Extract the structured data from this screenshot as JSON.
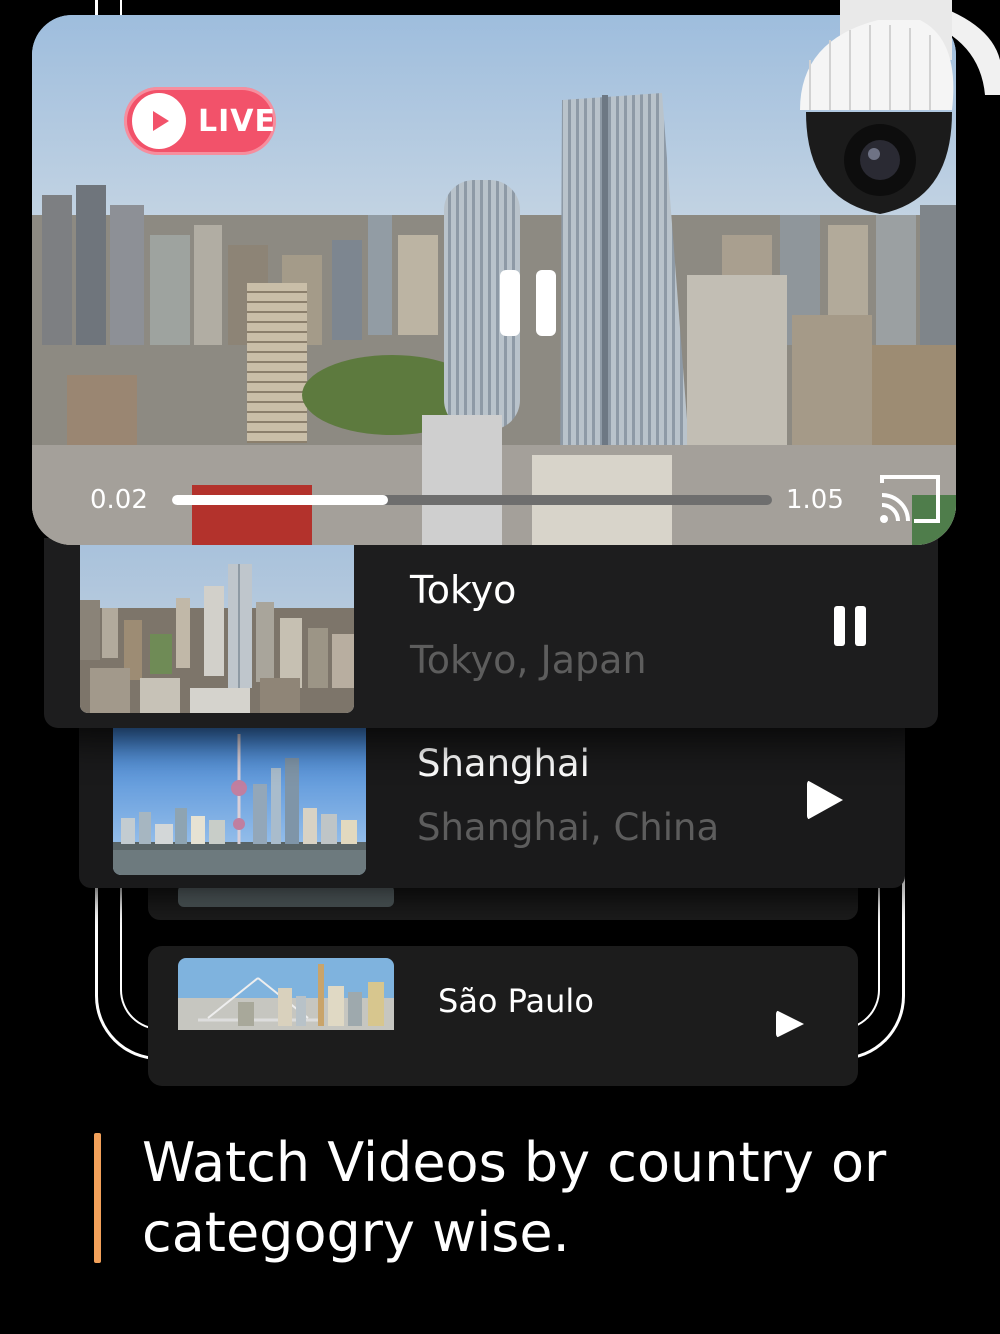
{
  "player": {
    "live_label": "LIVE",
    "time_elapsed": "0.02",
    "time_total": "1.05",
    "progress": 0.36
  },
  "icons": {
    "live": "play-circle-icon",
    "main_control": "pause-icon",
    "cast": "cast-icon",
    "camera": "security-camera-icon"
  },
  "list": {
    "items": [
      {
        "title": "Tokyo",
        "subtitle": "Tokyo, Japan",
        "control": "pause-icon"
      },
      {
        "title": "Shanghai",
        "subtitle": "Shanghai, China",
        "control": "play-icon"
      },
      {
        "title": "São Paulo",
        "subtitle": "",
        "control": "play-icon"
      }
    ]
  },
  "caption": {
    "text": "Watch Videos by country or categogry wise."
  },
  "colors": {
    "live_badge": "#f2526a",
    "accent_bar": "#f2a15a",
    "card_bg": "#1d1d1e",
    "subtitle": "#5d5d5d"
  }
}
